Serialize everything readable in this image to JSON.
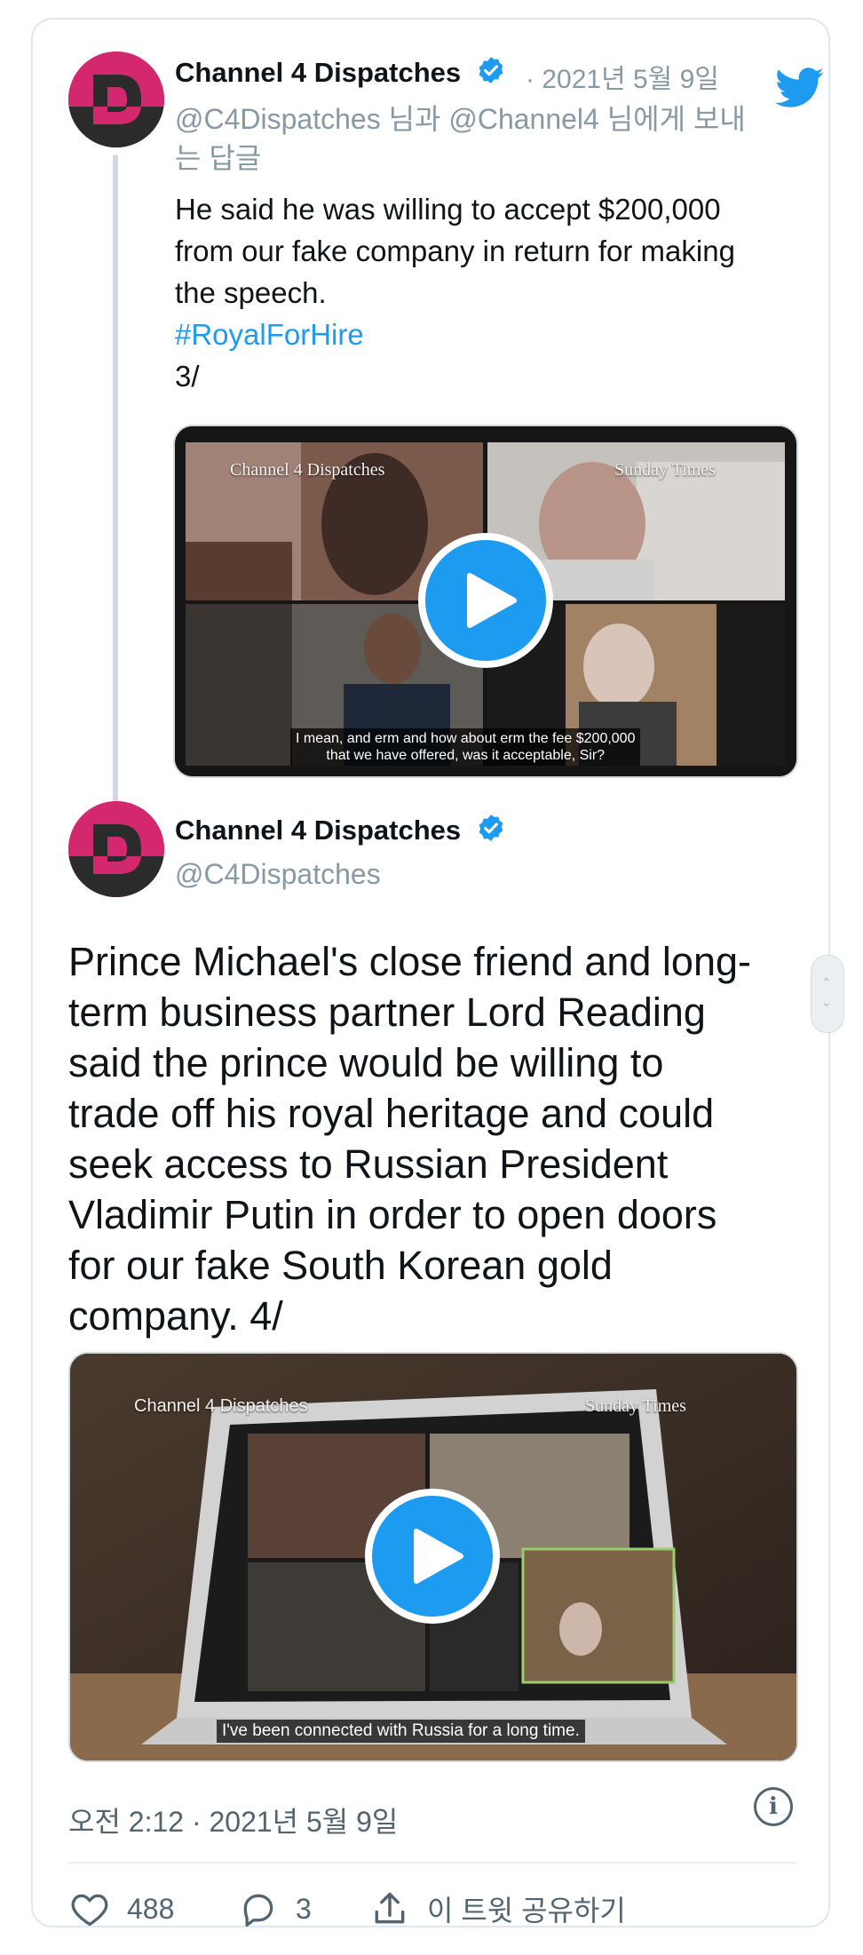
{
  "tweet3": {
    "display_name": "Channel 4 Dispatches",
    "date": "· 2021년 5월 9일",
    "reply_line1": "@C4Dispatches 님과 @Channel4 님에게 보내",
    "reply_line2": "는 답글",
    "text_lines": [
      "He said he was willing to accept $200,000",
      "from our fake company in return for making",
      "the speech."
    ],
    "hashtag": "#RoyalForHire",
    "counter": "3/",
    "video": {
      "watermark_left": "Channel 4 Dispatches",
      "watermark_right": "Sunday Times",
      "caption_line1": "I mean, and erm and how about erm the fee $200,000",
      "caption_line2": "that we have offered, was it acceptable, Sir?"
    }
  },
  "tweet4": {
    "display_name": "Channel 4 Dispatches",
    "handle": "@C4Dispatches",
    "text_lines": [
      "Prince Michael's close friend and long-",
      "term business partner Lord Reading",
      "said the prince would be willing to",
      "trade off his royal heritage and could",
      "seek access to Russian President",
      "Vladimir Putin in order to open doors",
      "for our fake South Korean gold",
      "company. 4/"
    ],
    "video": {
      "watermark_left": "Channel 4 Dispatches",
      "watermark_right": "Sunday Times",
      "caption": "I've been connected with Russia for a long time."
    },
    "timestamp": "오전 2:12 · 2021년 5월 9일",
    "actions": {
      "likes": "488",
      "replies": "3",
      "share_label": "이 트윗 공유하기"
    }
  },
  "colors": {
    "link": "#1d9bf0",
    "secondary_text": "#8899a6",
    "avatar": "#c2185b"
  },
  "icons": [
    "twitter-bird-icon",
    "verified-badge-icon",
    "play-icon",
    "heart-icon",
    "reply-icon",
    "share-icon",
    "info-icon"
  ]
}
